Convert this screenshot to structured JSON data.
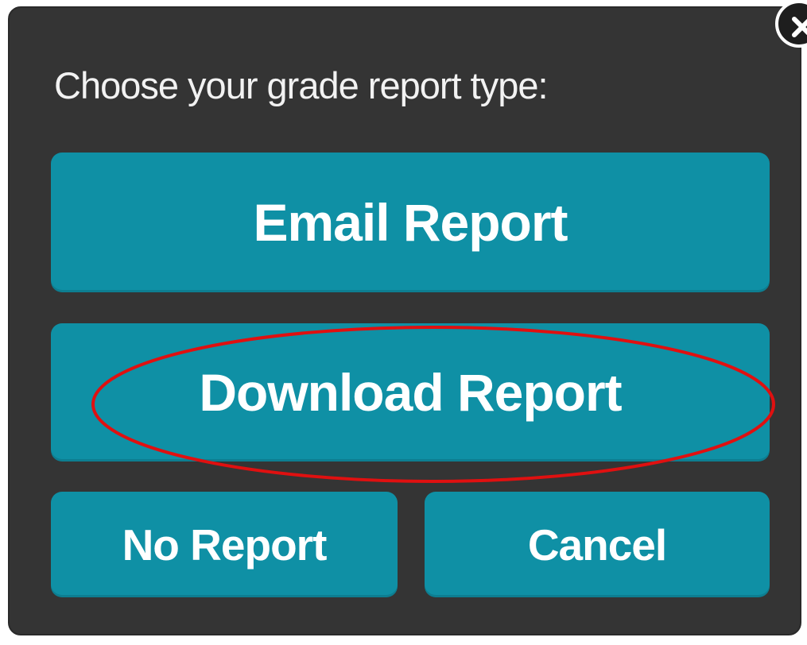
{
  "dialog": {
    "prompt": "Choose your grade report type:",
    "buttons": {
      "email": "Email Report",
      "download": "Download Report",
      "no_report": "No Report",
      "cancel": "Cancel"
    },
    "close_icon": "close-icon"
  },
  "annotation": {
    "type": "ellipse-highlight",
    "target": "Download Report",
    "color": "#e01010"
  },
  "colors": {
    "dialog_background": "#343434",
    "button_background": "#0f90a5",
    "button_text": "#ffffff",
    "prompt_text": "#f2f2f2"
  }
}
